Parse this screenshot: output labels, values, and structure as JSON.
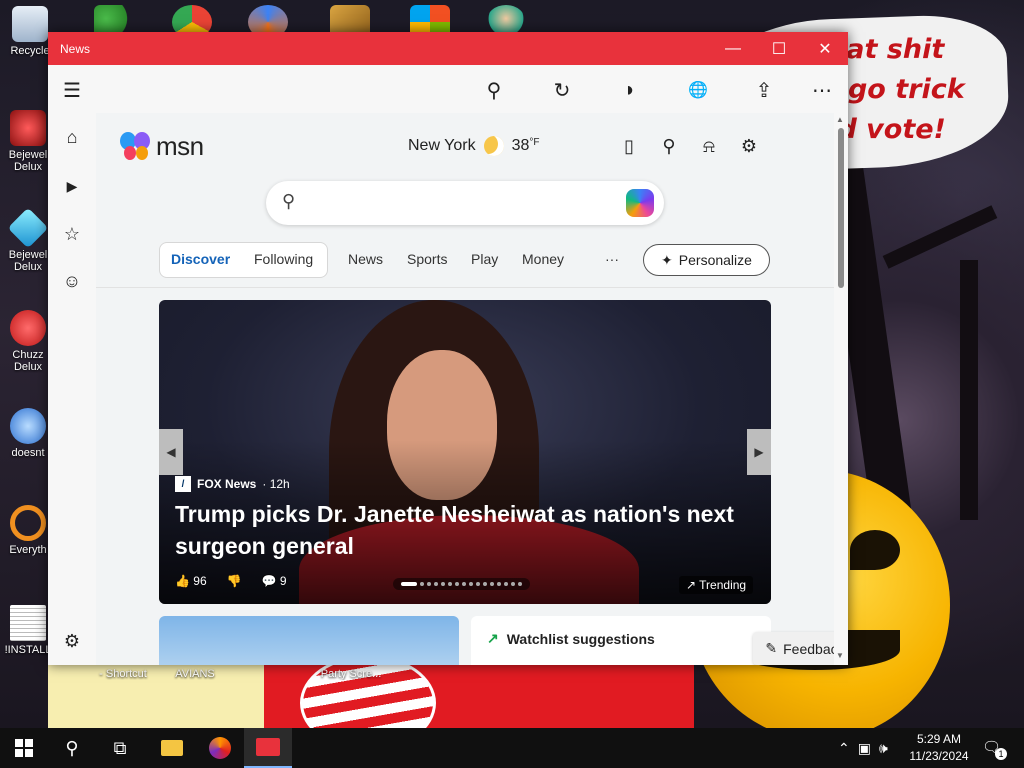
{
  "desktop": {
    "wallpaper_text": "o eat shit\nnd go trick\nand vote!",
    "icons": [
      {
        "label": "Recycle",
        "color": "#c8d6e6"
      },
      {
        "label": "Bejewel\nDelux",
        "color": "#d23a3a"
      },
      {
        "label": "Bejewel\nDelux",
        "color": "#40c6ff"
      },
      {
        "label": "Chuzz\nDelux",
        "color": "#e03030"
      },
      {
        "label": "doesnt",
        "color": "#3a8de0"
      },
      {
        "label": "Everyth",
        "color": "#f09020"
      },
      {
        "label": "!INSTALL",
        "color": "#f0f0f0"
      }
    ],
    "bottom_labels": [
      "- Shortcut",
      "AVIANS",
      "Party Scre..."
    ]
  },
  "window": {
    "title": "News",
    "minimize": "—",
    "maximize": "☐",
    "close": "✕"
  },
  "toolbar": {
    "menu_icon": "☰",
    "pin_icon": "⚲",
    "refresh_icon": "↻",
    "dark_icon": "◗",
    "globe_icon": "🌐",
    "share_icon": "⇪",
    "more_icon": "⋯"
  },
  "rail": {
    "home_icon": "⌂",
    "video_icon": "▶",
    "list_icon": "☆",
    "smile_icon": "☺",
    "settings_icon": "⚙"
  },
  "header": {
    "logo_text": "msn",
    "location": "New York",
    "temperature": "38",
    "temp_unit": "°F"
  },
  "search": {
    "placeholder": ""
  },
  "nav": {
    "tabs": [
      "Discover",
      "Following",
      "News",
      "Sports",
      "Play",
      "Money"
    ],
    "more": "···",
    "personalize": "Personalize"
  },
  "hero": {
    "source": "FOX News",
    "age": "· 12h",
    "headline": "Trump picks Dr. Janette Nesheiwat as nation's next surgeon general",
    "likes": "96",
    "comments": "9",
    "trending": "Trending"
  },
  "cards": {
    "watchlist_title": "Watchlist suggestions"
  },
  "feedback": {
    "label": "Feedback"
  },
  "taskbar": {
    "time": "5:29 AM",
    "date": "11/23/2024",
    "notification_count": "1"
  },
  "colors": {
    "titlebar": "#e8323c",
    "accent": "#1463b8"
  }
}
